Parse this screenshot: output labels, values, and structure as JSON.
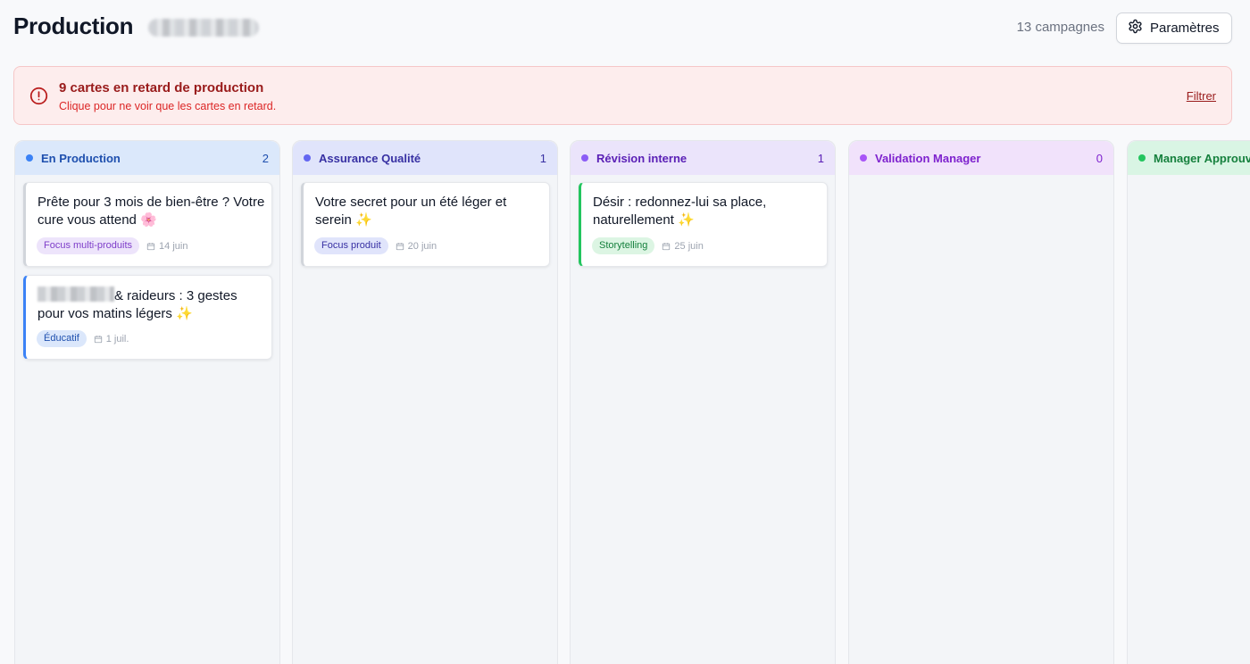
{
  "header": {
    "title": "Production",
    "campaign_count": "13 campagnes",
    "settings_label": "Paramètres"
  },
  "alert": {
    "title": "9 cartes en retard de production",
    "subtitle": "Clique pour ne voir que les cartes en retard.",
    "filter_label": "Filtrer"
  },
  "columns": [
    {
      "title": "En Production",
      "count": "2",
      "header_bg": "#dbe8fb",
      "text_color": "#1e4fae",
      "dot_color": "#3b82f6",
      "cards": [
        {
          "title": "Prête pour 3 mois de bien-être ? Votre cure vous attend 🌸",
          "tag": "Focus multi-produits",
          "date": "14 juin",
          "accent": "#d1d5db",
          "tag_bg": "#ede4fb",
          "tag_color": "#7e3dc9"
        },
        {
          "title": "& raideurs : 3 gestes pour vos matins légers ✨",
          "tag": "Éducatif",
          "date": "1 juil.",
          "accent": "#3b82f6",
          "tag_bg": "#dbe7fb",
          "tag_color": "#1e4fae"
        }
      ]
    },
    {
      "title": "Assurance Qualité",
      "count": "1",
      "header_bg": "#e0e4fb",
      "text_color": "#3730a3",
      "dot_color": "#6366f1",
      "cards": [
        {
          "title": "Votre secret pour un été léger et serein ✨",
          "tag": "Focus produit",
          "date": "20 juin",
          "accent": "#d1d5db",
          "tag_bg": "#e0e4fb",
          "tag_color": "#3730a3"
        }
      ]
    },
    {
      "title": "Révision interne",
      "count": "1",
      "header_bg": "#ebe4fb",
      "text_color": "#5b21b6",
      "dot_color": "#8b5cf6",
      "cards": [
        {
          "title": "Désir : redonnez-lui sa place, naturellement ✨",
          "tag": "Storytelling",
          "date": "25 juin",
          "accent": "#22c55e",
          "tag_bg": "#dcf5e3",
          "tag_color": "#15803d"
        }
      ]
    },
    {
      "title": "Validation Manager",
      "count": "0",
      "header_bg": "#f1e2fb",
      "text_color": "#7e22ce",
      "dot_color": "#a855f7",
      "cards": []
    },
    {
      "title": "Manager Approuvé",
      "count": "",
      "header_bg": "#d9f5e4",
      "text_color": "#15803d",
      "dot_color": "#22c55e",
      "cards": []
    }
  ]
}
